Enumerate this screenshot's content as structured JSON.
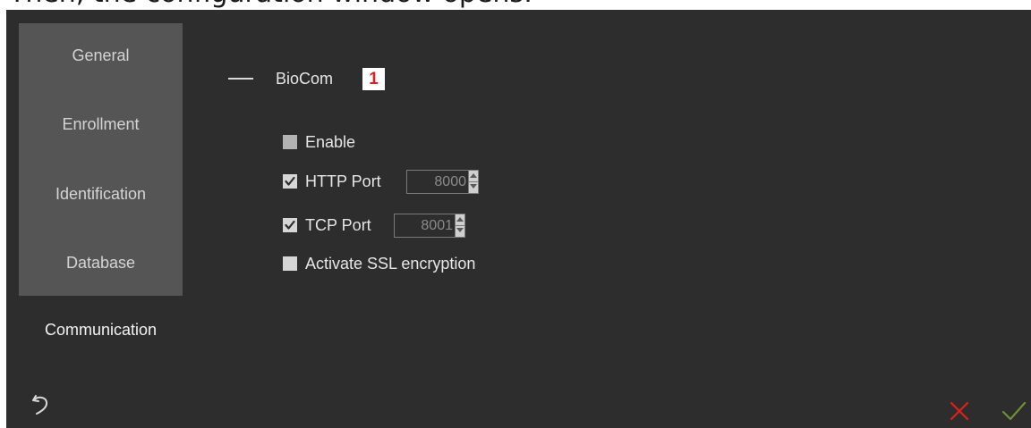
{
  "caption": {
    "clipped_text": "Then, the configuration window opens:"
  },
  "sidebar": {
    "items": [
      {
        "label": "General",
        "active": false
      },
      {
        "label": "Enrollment",
        "active": false
      },
      {
        "label": "Identification",
        "active": false
      },
      {
        "label": "Database",
        "active": false
      },
      {
        "label": "Communication",
        "active": true
      }
    ],
    "back_icon": "undo-arrow-icon"
  },
  "section": {
    "collapse_icon": "minus-icon",
    "title": "BioCom",
    "badge": "1"
  },
  "options": {
    "enable": {
      "label": "Enable",
      "checked": false
    },
    "http_port": {
      "label": "HTTP Port",
      "checked": true,
      "value": "8000"
    },
    "tcp_port": {
      "label": "TCP Port",
      "checked": true,
      "value": "8001"
    },
    "ssl": {
      "label": "Activate SSL encryption",
      "checked": false
    }
  },
  "footer": {
    "cancel_icon": "close-x-icon",
    "confirm_icon": "checkmark-icon"
  },
  "colors": {
    "background": "#2d2d2d",
    "sidebar": "#555555",
    "text": "#e6e6e6",
    "cancel": "#e0201b",
    "confirm": "#6f8f3a",
    "badge_text": "#e0201b"
  }
}
